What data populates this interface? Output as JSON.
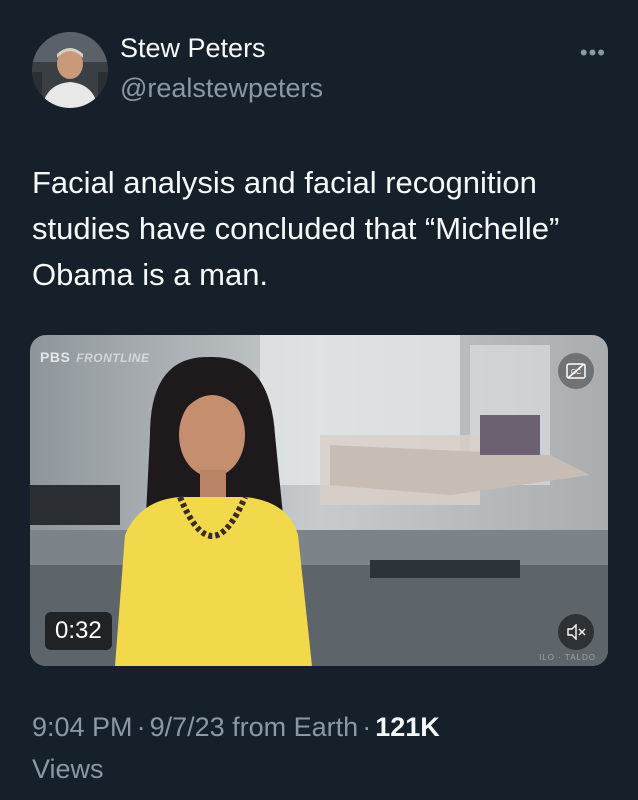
{
  "author": {
    "display_name": "Stew Peters",
    "handle": "@realstewpeters",
    "avatar_icon": "profile-photo"
  },
  "more_icon": "more-horizontal-icon",
  "tweet": {
    "text": "Facial analysis and facial recognition studies have concluded that “Michelle” Obama is a man."
  },
  "media": {
    "brand_logo": "PBS",
    "brand_sub": "FRONTLINE",
    "duration": "0:32",
    "watermark": "ILO · TALDO",
    "cc_icon": "captions-off-icon",
    "mute_icon": "volume-muted-icon"
  },
  "meta": {
    "time": "9:04 PM",
    "date": "9/7/23",
    "source": "from Earth",
    "views_count": "121K",
    "views_label": "Views",
    "separator": "·"
  },
  "colors": {
    "background": "#15202b",
    "primary_text": "#f7f9f9",
    "secondary_text": "#8b98a5",
    "dress": "#f2d84b"
  }
}
